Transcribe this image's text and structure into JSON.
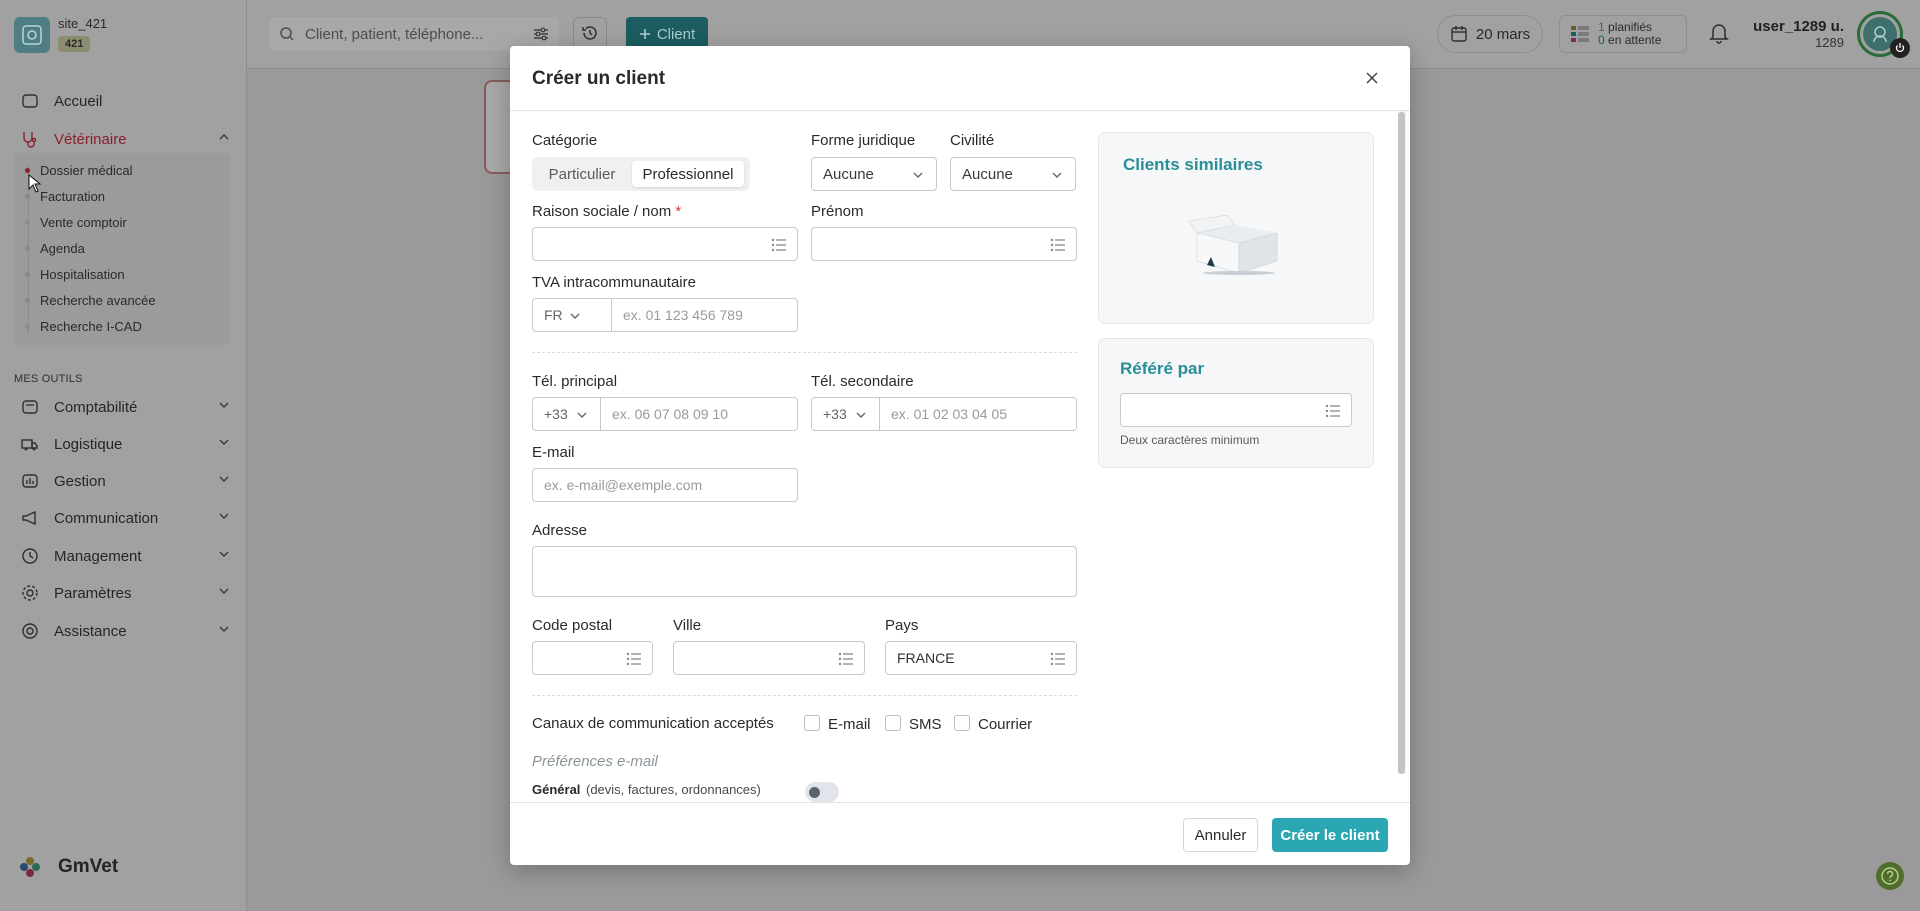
{
  "site": {
    "name": "site_421",
    "badge": "421"
  },
  "sidebar": {
    "items": [
      {
        "label": "Accueil",
        "icon": "home-icon"
      },
      {
        "label": "Vétérinaire",
        "icon": "stethoscope-icon",
        "active": true
      }
    ],
    "subitems": [
      {
        "label": "Dossier médical",
        "active": true
      },
      {
        "label": "Facturation"
      },
      {
        "label": "Vente comptoir"
      },
      {
        "label": "Agenda"
      },
      {
        "label": "Hospitalisation"
      },
      {
        "label": "Recherche avancée"
      },
      {
        "label": "Recherche I-CAD"
      }
    ],
    "section_title": "MES OUTILS",
    "tools": [
      {
        "label": "Comptabilité",
        "icon": "calculator-icon"
      },
      {
        "label": "Logistique",
        "icon": "truck-icon"
      },
      {
        "label": "Gestion",
        "icon": "chart-icon"
      },
      {
        "label": "Communication",
        "icon": "megaphone-icon"
      },
      {
        "label": "Management",
        "icon": "management-icon"
      },
      {
        "label": "Paramètres",
        "icon": "gear-icon"
      },
      {
        "label": "Assistance",
        "icon": "lifebuoy-icon"
      }
    ],
    "brand": "GmVet"
  },
  "topbar": {
    "search_placeholder": "Client, patient, téléphone...",
    "client_button": "Client",
    "date": "20 mars",
    "planned": {
      "count": "1",
      "label": "planifiés"
    },
    "pending": {
      "count": "0",
      "label": "en attente"
    },
    "user_name": "user_1289 u.",
    "user_id": "1289"
  },
  "modal": {
    "title": "Créer un client",
    "categorie_label": "Catégorie",
    "categorie_options": [
      "Particulier",
      "Professionnel"
    ],
    "categorie_selected": "Professionnel",
    "forme_label": "Forme juridique",
    "forme_value": "Aucune",
    "civilite_label": "Civilité",
    "civilite_value": "Aucune",
    "raison_label": "Raison sociale / nom",
    "required_mark": "*",
    "raison_value": "",
    "prenom_label": "Prénom",
    "prenom_value": "",
    "tva_label": "TVA intracommunautaire",
    "tva_country": "FR",
    "tva_placeholder": "ex. 01 123 456 789",
    "tel1_label": "Tél. principal",
    "tel1_prefix": "+33",
    "tel1_placeholder": "ex. 06 07 08 09 10",
    "tel2_label": "Tél. secondaire",
    "tel2_prefix": "+33",
    "tel2_placeholder": "ex. 01 02 03 04 05",
    "email_label": "E-mail",
    "email_placeholder": "ex. e-mail@exemple.com",
    "adresse_label": "Adresse",
    "adresse_value": "",
    "cp_label": "Code postal",
    "ville_label": "Ville",
    "pays_label": "Pays",
    "pays_value": "FRANCE",
    "canaux_label": "Canaux de communication acceptés",
    "canaux": [
      {
        "label": "E-mail",
        "checked": false
      },
      {
        "label": "SMS",
        "checked": false
      },
      {
        "label": "Courrier",
        "checked": false
      }
    ],
    "pref_title": "Préférences e-mail",
    "pref_general": "Général",
    "pref_general_sub": "(devis, factures, ordonnances)",
    "pref_general_on": false,
    "similar_title": "Clients similaires",
    "refere_title": "Référé par",
    "refere_value": "",
    "refere_hint": "Deux caractères minimum",
    "cancel_label": "Annuler",
    "create_label": "Créer le client"
  },
  "colors": {
    "accent": "#2aa7b2",
    "panel_title": "#2a8e98",
    "active_nav": "#8b2030",
    "overlay": "#9a9a9a"
  }
}
